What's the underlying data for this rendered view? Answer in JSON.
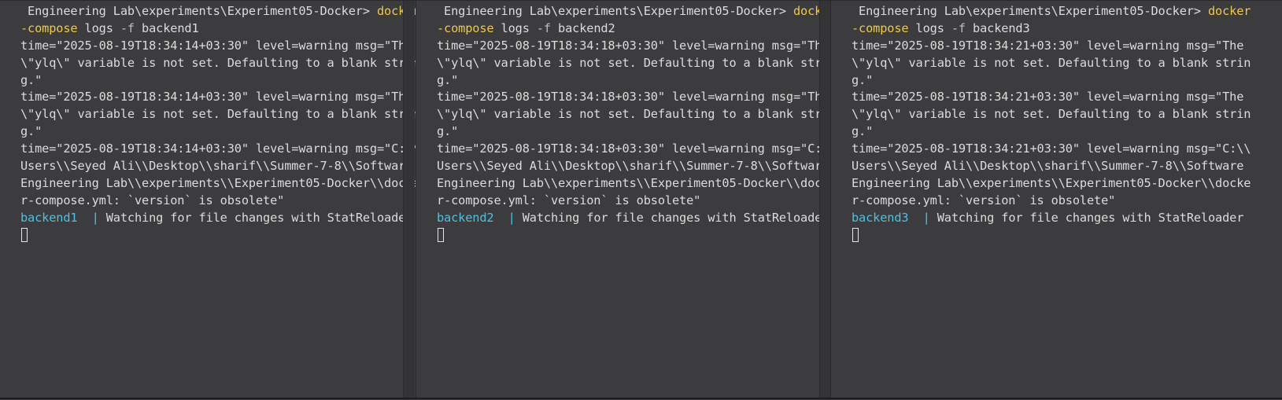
{
  "panes": [
    {
      "prompt": " Engineering Lab\\experiments\\Experiment05-Docker> ",
      "cmd_part1": "docker",
      "cmd_part2": "-compose",
      "cmd_args_pre": " logs ",
      "cmd_flag": "-f",
      "cmd_args_post": " backend1",
      "lines": [
        "time=\"2025-08-19T18:34:14+03:30\" level=warning msg=\"The",
        "\\\"ylq\\\" variable is not set. Defaulting to a blank strin",
        "g.\"",
        "time=\"2025-08-19T18:34:14+03:30\" level=warning msg=\"The",
        "\\\"ylq\\\" variable is not set. Defaulting to a blank strin",
        "g.\"",
        "time=\"2025-08-19T18:34:14+03:30\" level=warning msg=\"C:\\\\",
        "Users\\\\Seyed Ali\\\\Desktop\\\\sharif\\\\Summer-7-8\\\\Software",
        "Engineering Lab\\\\experiments\\\\Experiment05-Docker\\\\docke",
        "r-compose.yml: `version` is obsolete\""
      ],
      "container": "backend1",
      "container_pad": "  ",
      "pipe": "| ",
      "log_message": "Watching for file changes with StatReloader"
    },
    {
      "prompt": " Engineering Lab\\experiments\\Experiment05-Docker> ",
      "cmd_part1": "docker",
      "cmd_part2": "-compose",
      "cmd_args_pre": " logs ",
      "cmd_flag": "-f",
      "cmd_args_post": " backend2",
      "lines": [
        "time=\"2025-08-19T18:34:18+03:30\" level=warning msg=\"The",
        "\\\"ylq\\\" variable is not set. Defaulting to a blank strin",
        "g.\"",
        "time=\"2025-08-19T18:34:18+03:30\" level=warning msg=\"The",
        "\\\"ylq\\\" variable is not set. Defaulting to a blank strin",
        "g.\"",
        "time=\"2025-08-19T18:34:18+03:30\" level=warning msg=\"C:\\\\",
        "Users\\\\Seyed Ali\\\\Desktop\\\\sharif\\\\Summer-7-8\\\\Software",
        "Engineering Lab\\\\experiments\\\\Experiment05-Docker\\\\docke",
        "r-compose.yml: `version` is obsolete\""
      ],
      "container": "backend2",
      "container_pad": "  ",
      "pipe": "| ",
      "log_message": "Watching for file changes with StatReloader"
    },
    {
      "prompt": " Engineering Lab\\experiments\\Experiment05-Docker> ",
      "cmd_part1": "docker",
      "cmd_part2": "-compose",
      "cmd_args_pre": " logs ",
      "cmd_flag": "-f",
      "cmd_args_post": " backend3",
      "lines": [
        "time=\"2025-08-19T18:34:21+03:30\" level=warning msg=\"The",
        "\\\"ylq\\\" variable is not set. Defaulting to a blank strin",
        "g.\"",
        "time=\"2025-08-19T18:34:21+03:30\" level=warning msg=\"The",
        "\\\"ylq\\\" variable is not set. Defaulting to a blank strin",
        "g.\"",
        "time=\"2025-08-19T18:34:21+03:30\" level=warning msg=\"C:\\\\",
        "Users\\\\Seyed Ali\\\\Desktop\\\\sharif\\\\Summer-7-8\\\\Software",
        "Engineering Lab\\\\experiments\\\\Experiment05-Docker\\\\docke",
        "r-compose.yml: `version` is obsolete\""
      ],
      "container": "backend3",
      "container_pad": "  ",
      "pipe": "| ",
      "log_message": "Watching for file changes with StatReloader"
    }
  ],
  "colors": {
    "background": "#3c3b3e",
    "text": "#dcdcdc",
    "command": "#f0c94a",
    "container_label": "#4fc1e0"
  },
  "icons": {
    "cursor": "block-cursor-icon"
  }
}
